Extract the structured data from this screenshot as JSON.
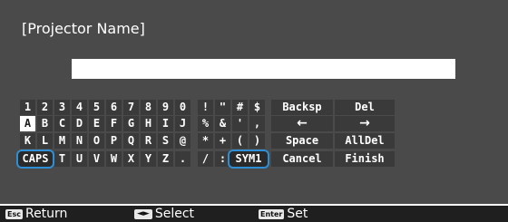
{
  "dialog": {
    "title": "[Projector Name]",
    "name_value": ""
  },
  "keyboard": {
    "rows": [
      [
        "1",
        "2",
        "3",
        "4",
        "5",
        "6",
        "7",
        "8",
        "9",
        "0",
        "!",
        "\"",
        "#",
        "$",
        "Backsp",
        "Del"
      ],
      [
        "A",
        "B",
        "C",
        "D",
        "E",
        "F",
        "G",
        "H",
        "I",
        "J",
        "%",
        "&",
        "'",
        ",",
        "←",
        "→"
      ],
      [
        "K",
        "L",
        "M",
        "N",
        "O",
        "P",
        "Q",
        "R",
        "S",
        "@",
        "*",
        "+",
        "(",
        ")",
        "Space",
        "AllDel"
      ],
      [
        "CAPS",
        "T",
        "U",
        "V",
        "W",
        "X",
        "Y",
        "Z",
        ".",
        "/",
        ":",
        "SYM1",
        "Cancel",
        "Finish"
      ]
    ],
    "selected_key": "A",
    "highlighted_keys": [
      "CAPS",
      "SYM1"
    ]
  },
  "footer": {
    "return": {
      "key": "Esc",
      "label": "Return"
    },
    "select": {
      "key": "◄►",
      "label": "Select"
    },
    "set": {
      "key": "Enter",
      "label": "Set"
    }
  },
  "colors": {
    "panel": "#4a4a4a",
    "highlight_ring": "#2f8fd6",
    "footer": "#1f1f1f"
  }
}
